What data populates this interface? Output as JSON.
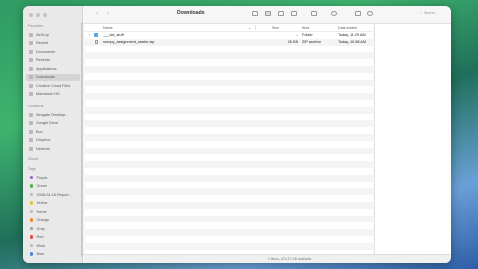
{
  "window": {
    "title": "Downloads"
  },
  "sidebar": {
    "favorites_header": "Favorites",
    "favorites": [
      {
        "label": "AirDrop",
        "icon": "airdrop-icon"
      },
      {
        "label": "Recent",
        "icon": "clock-icon"
      },
      {
        "label": "Documents",
        "icon": "document-icon"
      },
      {
        "label": "Recents",
        "icon": "clock-icon"
      },
      {
        "label": "Applications",
        "icon": "applications-icon"
      },
      {
        "label": "Downloads",
        "icon": "download-icon",
        "selected": true
      },
      {
        "label": "Creative Cloud Files",
        "icon": "cloud-icon"
      },
      {
        "label": "Macintosh HD",
        "icon": "disk-icon"
      }
    ],
    "locations_header": "Locations",
    "locations": [
      {
        "label": "Seagate Desktop...",
        "icon": "disk-icon"
      },
      {
        "label": "Google Drive",
        "icon": "drive-icon"
      },
      {
        "label": "Box",
        "icon": "box-icon"
      },
      {
        "label": "Dropbox",
        "icon": "dropbox-icon"
      },
      {
        "label": "Network",
        "icon": "network-icon"
      }
    ],
    "icloud_header": "iCloud",
    "tags_header": "Tags",
    "tags": [
      {
        "label": "Purple",
        "color": "#a05cd6"
      },
      {
        "label": "Green",
        "color": "#4cb34c"
      },
      {
        "label": "2008-04-18-Report...",
        "color": "#b8b8b8"
      },
      {
        "label": "Yellow",
        "color": "#e6c52e"
      },
      {
        "label": "Home",
        "color": "#b8b8b8"
      },
      {
        "label": "Orange",
        "color": "#ef8b2c"
      },
      {
        "label": "Gray",
        "color": "#9a9a9a"
      },
      {
        "label": "Red",
        "color": "#e5493f"
      },
      {
        "label": "Work",
        "color": "#b8b8b8"
      },
      {
        "label": "Blue",
        "color": "#3f87e5"
      }
    ]
  },
  "toolbar": {
    "back_label": "‹",
    "forward_label": "›",
    "search_placeholder": "Search"
  },
  "columns": {
    "name": "Name",
    "size": "Size",
    "kind": "Kind",
    "date_added": "Date Added"
  },
  "files": [
    {
      "name": "___old_stuff",
      "size": "--",
      "kind": "Folder",
      "date_added": "Today, 11:29 AM",
      "type": "folder"
    },
    {
      "name": "numpy_assignment_starter.zip",
      "size": "26 KB",
      "kind": "ZIP archive",
      "date_added": "Today, 10:38 AM",
      "type": "file"
    }
  ],
  "status": {
    "text": "2 items, 474.37 GB available"
  }
}
